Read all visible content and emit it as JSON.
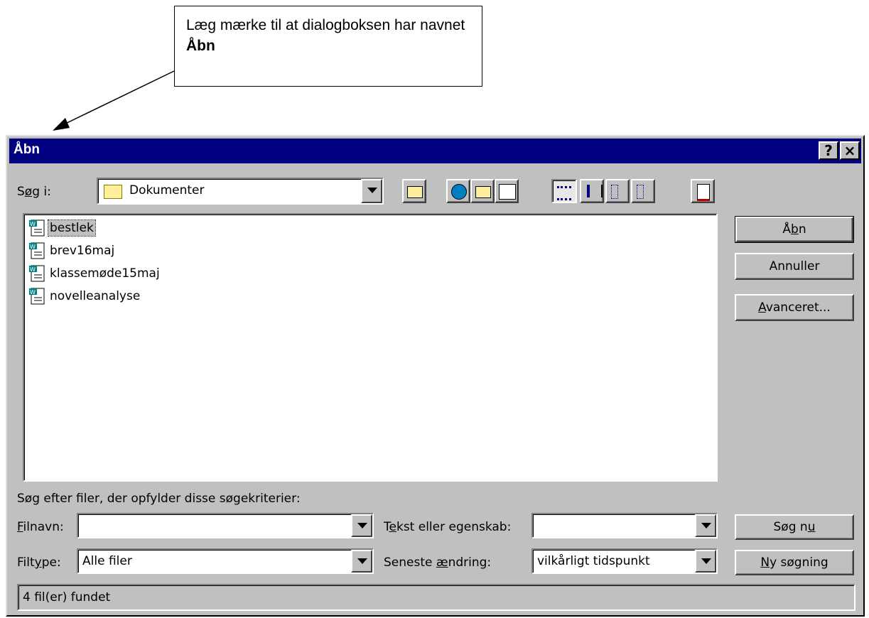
{
  "callout": {
    "text_before": "Læg mærke til at dialogboksen har navnet ",
    "bold": "Åbn"
  },
  "dialog": {
    "title": "Åbn",
    "help_btn": "?",
    "close_btn": "×",
    "look_in_label": "Søg i:",
    "look_in_value": "Dokumenter",
    "files": [
      "bestlek",
      "brev16maj",
      "klassemøde15maj",
      "novelleanalyse"
    ],
    "buttons": {
      "open": "Åbn",
      "cancel": "Annuller",
      "advanced": "Avanceret...",
      "search_now": "Søg nu",
      "new_search": "Ny søgning"
    },
    "criteria_heading": "Søg efter filer, der opfylder disse søgekriterier:",
    "filename_label": "Filnavn:",
    "filename_value": "",
    "filetype_label": "Filtype:",
    "filetype_value": "Alle filer",
    "text_prop_label": "Tekst eller egenskab:",
    "text_prop_value": "",
    "last_modified_label": "Seneste ændring:",
    "last_modified_value": "vilkårligt tidspunkt",
    "status": "4 fil(er) fundet"
  },
  "colors": {
    "titlebar": "#000080",
    "face": "#c0c0c0"
  }
}
